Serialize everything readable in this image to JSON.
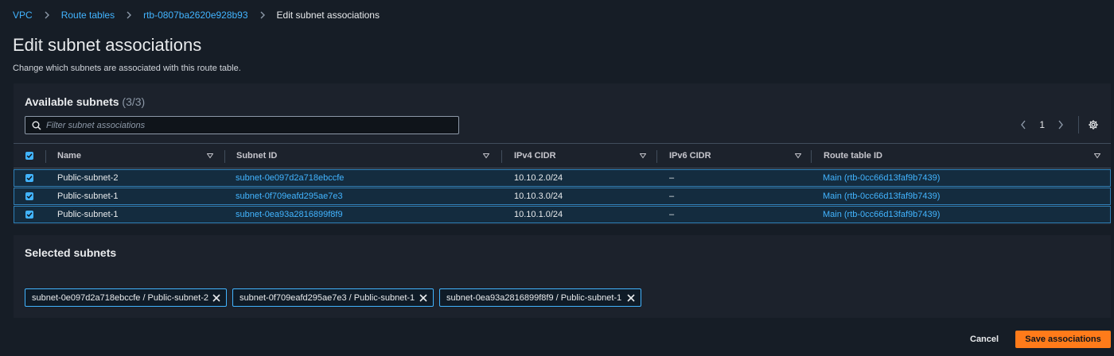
{
  "breadcrumb": {
    "items": [
      "VPC",
      "Route tables",
      "rtb-0807ba2620e928b93"
    ],
    "current": "Edit subnet associations"
  },
  "page": {
    "title": "Edit subnet associations",
    "description": "Change which subnets are associated with this route table."
  },
  "available": {
    "heading": "Available subnets",
    "count": "(3/3)",
    "filter_placeholder": "Filter subnet associations",
    "page_number": "1",
    "columns": [
      "Name",
      "Subnet ID",
      "IPv4 CIDR",
      "IPv6 CIDR",
      "Route table ID"
    ],
    "rows": [
      {
        "name": "Public-subnet-2",
        "subnet_id": "subnet-0e097d2a718ebccfe",
        "ipv4": "10.10.2.0/24",
        "ipv6": "–",
        "route_table": "Main (rtb-0cc66d13faf9b7439)",
        "checked": true
      },
      {
        "name": "Public-subnet-1",
        "subnet_id": "subnet-0f709eafd295ae7e3",
        "ipv4": "10.10.3.0/24",
        "ipv6": "–",
        "route_table": "Main (rtb-0cc66d13faf9b7439)",
        "checked": true
      },
      {
        "name": "Public-subnet-1",
        "subnet_id": "subnet-0ea93a2816899f8f9",
        "ipv4": "10.10.1.0/24",
        "ipv6": "–",
        "route_table": "Main (rtb-0cc66d13faf9b7439)",
        "checked": true
      }
    ]
  },
  "selected": {
    "heading": "Selected subnets",
    "tokens": [
      "subnet-0e097d2a718ebccfe / Public-subnet-2",
      "subnet-0f709eafd295ae7e3 / Public-subnet-1",
      "subnet-0ea93a2816899f8f9 / Public-subnet-1"
    ]
  },
  "actions": {
    "cancel": "Cancel",
    "save": "Save associations"
  },
  "colors": {
    "background": "#161d26",
    "panel": "#1c222c",
    "link": "#42b4ff",
    "primary_button": "#ff7b1a",
    "selected_row": "#142c3f"
  },
  "icons": {
    "breadcrumb_separator": "chevron-right-icon",
    "filter": "search-icon",
    "pager_prev": "chevron-left-icon",
    "pager_next": "chevron-right-icon",
    "preferences": "gear-icon",
    "sort": "caret-down-icon",
    "token_remove": "close-icon",
    "checkbox": "checkmark-icon"
  }
}
